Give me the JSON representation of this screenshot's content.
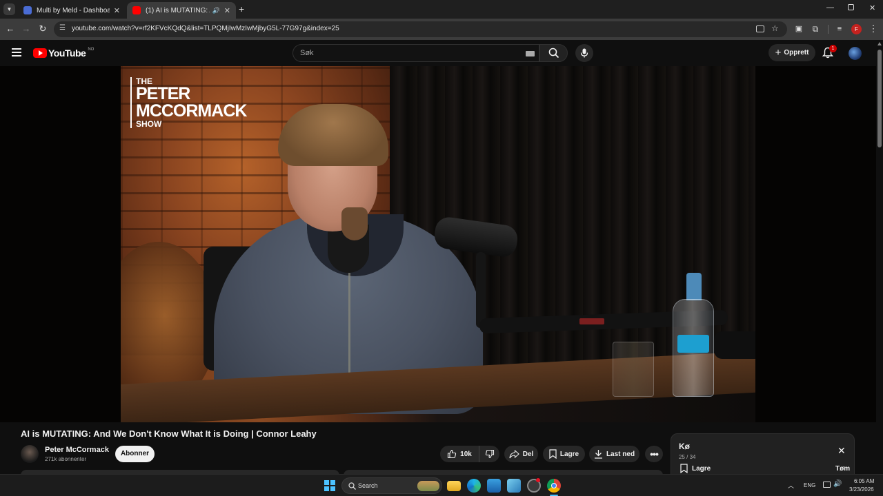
{
  "browser": {
    "tabs": [
      {
        "title": "Multi by Meld - Dashboard.",
        "active": false
      },
      {
        "title": "(1) AI is MUTATING: And We",
        "active": true
      }
    ],
    "url": "youtube.com/watch?v=rf2KFVcKQdQ&list=TLPQMjIwMzIwMjbyG5L-77G97g&index=25",
    "profile_initial": "F"
  },
  "youtube": {
    "logo_text": "YouTube",
    "region": "NO",
    "search_placeholder": "Søk",
    "create_label": "Opprett",
    "notification_count": "1"
  },
  "video": {
    "show_logo": {
      "line1": "THE",
      "line2": "PETER",
      "line3": "MCCORMACK",
      "line4": "SHOW"
    },
    "title": "AI is MUTATING: And We Don't Know What It is Doing | Connor Leahy",
    "channel": "Peter McCormack",
    "subscribers": "271k abonnenter",
    "subscribe_label": "Abonner",
    "likes": "10k",
    "share_label": "Del",
    "save_label": "Lagre",
    "download_label": "Last ned"
  },
  "queue": {
    "title": "Kø",
    "position": "25 / 34",
    "save_label": "Lagre",
    "clear_label": "Tøm"
  },
  "taskbar": {
    "search_label": "Search",
    "lang": "ENG",
    "time": "6:05 AM",
    "date": "3/23/2026"
  },
  "colors": {
    "yt_red": "#ff0000",
    "accent_blue": "#3ea6ff",
    "subscribe_bg": "#f1f1f1"
  }
}
